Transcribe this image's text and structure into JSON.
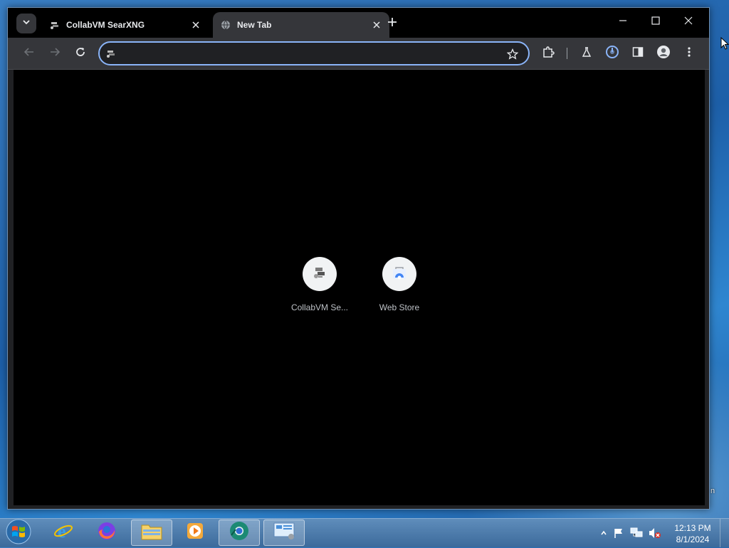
{
  "browser": {
    "tabs": [
      {
        "title": "CollabVM SearXNG",
        "active": false
      },
      {
        "title": "New Tab",
        "active": true
      }
    ],
    "omnibox": {
      "value": "",
      "placeholder": ""
    }
  },
  "new_tab_page": {
    "shortcuts": [
      {
        "label": "CollabVM Se...",
        "icon": "collabvm-favicon"
      },
      {
        "label": "Web Store",
        "icon": "web-store-icon"
      }
    ]
  },
  "taskbar": {
    "clock_time": "12:13 PM",
    "clock_date": "8/1/2024",
    "pinned": [
      "internet-explorer-icon",
      "firefox-icon",
      "file-explorer-icon",
      "media-player-icon",
      "chrome-icon",
      "control-panel-icon"
    ]
  },
  "desktop": {
    "edge_fragment": "n"
  },
  "colors": {
    "accent": "#8ab4f8",
    "window_bg": "#202124",
    "toolbar_bg": "#35363a",
    "content_bg": "#000000"
  }
}
